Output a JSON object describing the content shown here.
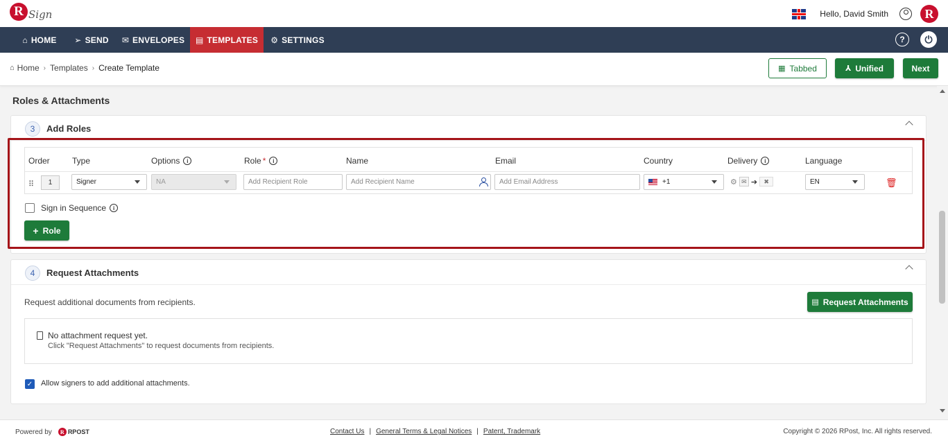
{
  "app": {
    "logo_letter": "R",
    "logo_text": "Sign"
  },
  "header": {
    "greeting": "Hello, David Smith",
    "avatar_letter": "R"
  },
  "nav": {
    "items": [
      {
        "label": "HOME",
        "icon": "home-icon",
        "glyph": "⌂"
      },
      {
        "label": "SEND",
        "icon": "send-icon",
        "glyph": "➢"
      },
      {
        "label": "ENVELOPES",
        "icon": "envelope-icon",
        "glyph": "✉"
      },
      {
        "label": "TEMPLATES",
        "icon": "template-icon",
        "glyph": "▤",
        "active": true
      },
      {
        "label": "SETTINGS",
        "icon": "gear-icon",
        "glyph": "⚙"
      }
    ],
    "help_glyph": "?",
    "power_glyph": "⏻"
  },
  "breadcrumb": {
    "home": "Home",
    "templates": "Templates",
    "current": "Create Template",
    "sep": "›"
  },
  "toolbar": {
    "tabbed": "Tabbed",
    "unified": "Unified",
    "next": "Next"
  },
  "page": {
    "section_title": "Roles & Attachments"
  },
  "roles": {
    "step": "3",
    "title": "Add Roles",
    "columns": {
      "order": "Order",
      "type": "Type",
      "options": "Options",
      "role": "Role",
      "role_required": "*",
      "name": "Name",
      "email": "Email",
      "country": "Country",
      "delivery": "Delivery",
      "language": "Language"
    },
    "row": {
      "order": "1",
      "type": "Signer",
      "options": "NA",
      "role_placeholder": "Add Recipient Role",
      "name_placeholder": "Add Recipient Name",
      "email_placeholder": "Add Email Address",
      "country_code": "+1",
      "language": "EN"
    },
    "sign_in_sequence": "Sign in Sequence",
    "add_role": "Role"
  },
  "attachments": {
    "step": "4",
    "title": "Request Attachments",
    "description": "Request additional documents from recipients.",
    "button": "Request Attachments",
    "empty_title": "No attachment request yet.",
    "empty_hint": "Click \"Request Attachments\" to request documents from recipients.",
    "allow_label": "Allow signers to add additional attachments."
  },
  "footer": {
    "powered_by": "Powered by",
    "brand": "RPOST",
    "links": [
      "Contact Us",
      "General Terms & Legal Notices",
      "Patent, Trademark"
    ],
    "copyright": "Copyright © 2026 RPost, Inc. All rights reserved."
  },
  "colors": {
    "nav_bg": "#2f3e55",
    "active_tab": "#c62d32",
    "primary_green": "#1e7b3a",
    "highlight": "#a51419"
  }
}
